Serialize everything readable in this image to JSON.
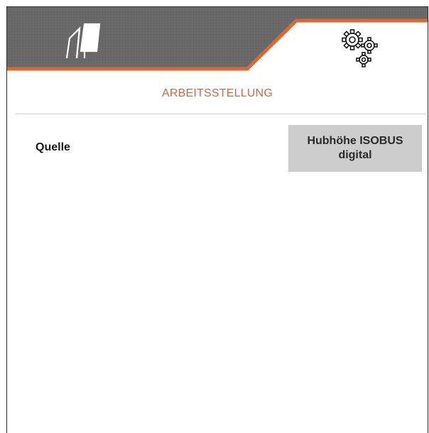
{
  "header": {
    "tabs": [
      {
        "icon": "tillage-icon",
        "active": false
      },
      {
        "icon": "gears-icon",
        "active": true
      }
    ],
    "accent_color": "#e0662f",
    "inactive_tab_color": "#666666"
  },
  "section": {
    "title": "ARBEITSSTELLUNG"
  },
  "settings": [
    {
      "label": "Quelle",
      "value": "Hubhöhe ISOBUS digital"
    }
  ]
}
